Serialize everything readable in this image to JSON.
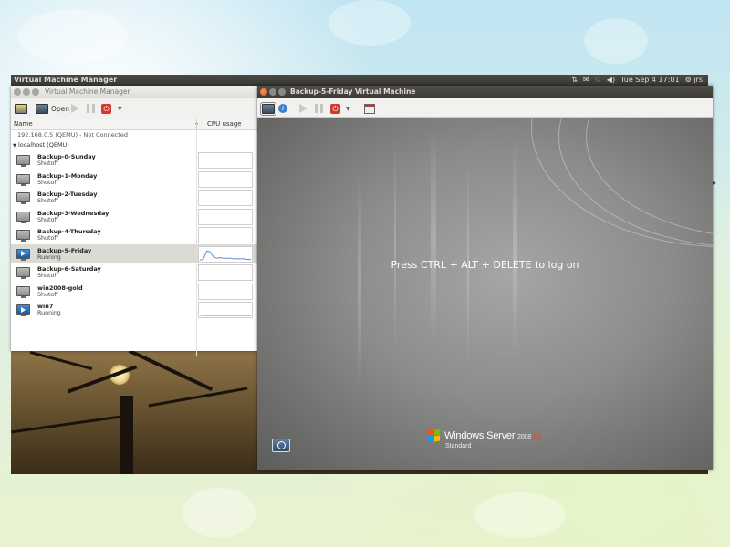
{
  "top_panel": {
    "title": "Virtual Machine Manager",
    "clock": "Tue Sep  4 17:01",
    "user": "jrs",
    "indicators": [
      "network-icon",
      "mail-icon",
      "wifi-icon",
      "volume-icon"
    ]
  },
  "vmm_window": {
    "title": "Virtual Machine Manager",
    "toolbar": {
      "open_label": "Open"
    },
    "columns": {
      "name": "Name",
      "cpu": "CPU usage"
    },
    "connection_line": "192.168.0.5 (QEMU) - Not Connected",
    "host": "localhost (QEMU)",
    "vms": [
      {
        "name": "Backup-0-Sunday",
        "state": "Shutoff",
        "running": false,
        "cpu": []
      },
      {
        "name": "Backup-1-Monday",
        "state": "Shutoff",
        "running": false,
        "cpu": []
      },
      {
        "name": "Backup-2-Tuesday",
        "state": "Shutoff",
        "running": false,
        "cpu": []
      },
      {
        "name": "Backup-3-Wednesday",
        "state": "Shutoff",
        "running": false,
        "cpu": []
      },
      {
        "name": "Backup-4-Thursday",
        "state": "Shutoff",
        "running": false,
        "cpu": []
      },
      {
        "name": "Backup-5-Friday",
        "state": "Running",
        "running": true,
        "selected": true,
        "cpu": [
          0.05,
          0.1,
          0.75,
          0.7,
          0.3,
          0.2,
          0.25,
          0.2,
          0.2,
          0.2,
          0.15,
          0.15,
          0.15,
          0.15,
          0.1,
          0.1
        ]
      },
      {
        "name": "Backup-6-Saturday",
        "state": "Shutoff",
        "running": false,
        "cpu": []
      },
      {
        "name": "win2008-gold",
        "state": "Shutoff",
        "running": false,
        "cpu": []
      },
      {
        "name": "win7",
        "state": "Running",
        "running": true,
        "cpu": [
          0.08,
          0.08,
          0.07,
          0.07,
          0.08,
          0.07,
          0.07,
          0.08,
          0.07,
          0.07,
          0.07,
          0.08,
          0.07,
          0.07,
          0.07,
          0.07
        ]
      }
    ]
  },
  "console_window": {
    "title": "Backup-5-Friday Virtual Machine",
    "logon_message": "Press CTRL + ALT + DELETE to log on",
    "brand": "Windows Server",
    "version": "2008",
    "release": "R2",
    "edition": "Standard"
  },
  "colors": {
    "power_red": "#d23a2d",
    "accent_orange": "#dd4814",
    "graph_blue": "#5b8fc7"
  }
}
